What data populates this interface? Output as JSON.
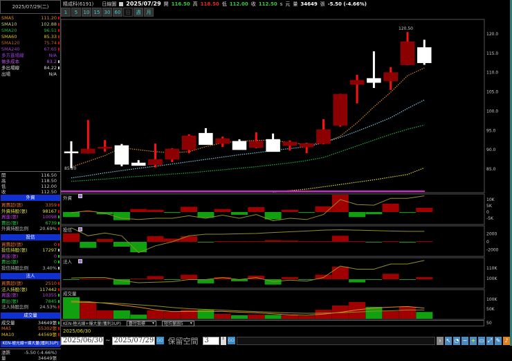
{
  "left": {
    "date": "2025/07/29(二)",
    "ma_rows": [
      {
        "label": "SMA5",
        "value": "111.20",
        "color": "#e08a20",
        "mark": "#e00000"
      },
      {
        "label": "SMA10",
        "value": "102.88",
        "color": "#c8c890",
        "mark": "#e00000"
      },
      {
        "label": "SMA20",
        "value": "96.51",
        "color": "#20b040",
        "mark": "#e00000"
      },
      {
        "label": "SMA60",
        "value": "85.33",
        "color": "#e0c020",
        "mark": "#e00000"
      },
      {
        "label": "SMA120",
        "value": "75.74",
        "color": "#c06020",
        "mark": "#e00000"
      },
      {
        "label": "SMA240",
        "value": "67.65",
        "color": "#a040c0",
        "mark": "#e00000"
      },
      {
        "label": "多方進場線",
        "value": "N/A",
        "color": "#a040e0",
        "mark": ""
      },
      {
        "label": "做多成本",
        "value": "83.2",
        "color": "#c050e0",
        "mark": "#ccc"
      },
      {
        "label": "多出場線",
        "value": "84.22",
        "color": "#ddd",
        "mark": "#ccc"
      },
      {
        "label": "出場",
        "value": "N/A",
        "color": "#ddd",
        "mark": ""
      }
    ],
    "ohlc_rows": [
      {
        "label": "開",
        "value": "116.50"
      },
      {
        "label": "高",
        "value": "118.50"
      },
      {
        "label": "低",
        "value": "112.00"
      },
      {
        "label": "收",
        "value": "112.50"
      }
    ],
    "sections": [
      {
        "title": "外資",
        "rows": [
          {
            "label": "買賣超(張)",
            "value": "3359",
            "color": "#e07030",
            "mark": "#e00000"
          },
          {
            "label": "外資持股(張)",
            "value": "98167",
            "color": "#e0e040",
            "mark": "#e00000"
          },
          {
            "label": "買進(張)",
            "value": "10098",
            "color": "#c040e0",
            "mark": "#20c020"
          },
          {
            "label": "賣出(張)",
            "value": "6739",
            "color": "#20d040",
            "mark": "#20c020"
          },
          {
            "label": "外資持股比例",
            "value": "20.69%",
            "color": "#bbb",
            "mark": "#e00000"
          }
        ]
      },
      {
        "title": "投信",
        "rows": [
          {
            "label": "買賣超(張)",
            "value": "0",
            "color": "#e07030",
            "mark": "#e00000"
          },
          {
            "label": "投信持股(張)",
            "value": "17297",
            "color": "#e0e040",
            "mark": "#ccc"
          },
          {
            "label": "買進(張)",
            "value": "0",
            "color": "#c040e0",
            "mark": "#20c020"
          },
          {
            "label": "賣出(張)",
            "value": "0",
            "color": "#20d040",
            "mark": "#20c020"
          },
          {
            "label": "投信持股比例",
            "value": "3.40%",
            "color": "#bbb",
            "mark": "#ccc"
          }
        ]
      },
      {
        "title": "法人",
        "rows": [
          {
            "label": "買賣超(張)",
            "value": "2510",
            "color": "#e07030",
            "mark": "#e00000"
          },
          {
            "label": "法人持股(張)",
            "value": "117442",
            "color": "#e0e040",
            "mark": "#e00000"
          },
          {
            "label": "買進(張)",
            "value": "10355",
            "color": "#c040e0",
            "mark": "#20c020"
          },
          {
            "label": "賣出(張)",
            "value": "7845",
            "color": "#20d040",
            "mark": "#20c020"
          },
          {
            "label": "法人持股比例",
            "value": "24.53%",
            "color": "#bbb",
            "mark": "#e00000"
          }
        ]
      },
      {
        "title": "成交量",
        "rows": [
          {
            "label": "成交量",
            "value": "34649張",
            "color": "#ddd",
            "mark": "#20c020"
          },
          {
            "label": "MA5",
            "value": "55302張",
            "color": "#e07030",
            "mark": "#e00000"
          },
          {
            "label": "MA10",
            "value": "44569張",
            "color": "#e0c020",
            "mark": "#e00000"
          }
        ]
      }
    ],
    "ken_label": "KEN-極光線+爆大量(獲利3UP)",
    "footer_rows": [
      {
        "label": "漲跌",
        "value": "-5.50 (-4.66%)"
      },
      {
        "label": "量",
        "value": "34649張"
      }
    ]
  },
  "topbar": {
    "stock": "精成科(6191)",
    "chart_type": "日線圖",
    "date": "2025/07/29",
    "open_label": "開",
    "open": "116.50",
    "high_label": "高",
    "high": "118.50",
    "low_label": "低",
    "low": "112.00",
    "close_label": "收",
    "close": "112.50",
    "unit1": "s",
    "unit2": "元",
    "vol_label": "量",
    "volume": "34649",
    "vol_unit": "張",
    "change": "-5.50 (-4.66%)"
  },
  "periods": [
    {
      "label": "1"
    },
    {
      "label": "5"
    },
    {
      "label": "10"
    },
    {
      "label": "15"
    },
    {
      "label": "30"
    },
    {
      "label": "60"
    },
    {
      "label": "日",
      "selected": true
    },
    {
      "label": "週"
    },
    {
      "label": "月"
    }
  ],
  "panels": {
    "foreign": "外資",
    "trust": "投信",
    "inst": "法人",
    "volume": "成交量"
  },
  "bottom": {
    "ken_label": "KEN-極光線+爆大量(獲利3UP)",
    "overlay_select": "疊付指標",
    "vol_select": "短均量圖5",
    "cursor_date": "2025/06/30",
    "start_date": "2025/06/30",
    "tilde": "~",
    "end_date": "2025/07/29",
    "go": "GO",
    "reserve_label": "保留空間",
    "reserve_value": "3",
    "right_axis_50": "50"
  },
  "colors": {
    "up_body": "#8b0000",
    "up_wick": "#ff1010",
    "down": "#ffffff",
    "ma5": "#e08a20",
    "ma10": "#80c8e0",
    "ma20": "#20b040",
    "ma60": "#e0e020",
    "bar_up": "#a00000",
    "bar_down": "#10a010",
    "line": "#909020"
  },
  "chart_data": [
    {
      "type": "candlestick",
      "title": "",
      "ylim": [
        79,
        123.4
      ],
      "yticks": [
        "120.0",
        "115.0",
        "110.0",
        "105.0",
        "100.0",
        "95.0",
        "90.0",
        "85.0"
      ],
      "ytick_values": [
        120,
        115,
        110,
        105,
        100,
        95,
        90,
        85
      ],
      "annotations": [
        {
          "text": "120.50",
          "index": 20
        },
        {
          "text": "85.20",
          "index": 0
        }
      ],
      "ohlc": [
        [
          89.5,
          92.2,
          85.2,
          89.3
        ],
        [
          89.1,
          97.7,
          89.0,
          90.2
        ],
        [
          90.5,
          92.5,
          89.5,
          90.7
        ],
        [
          91.1,
          91.5,
          85.7,
          86.2
        ],
        [
          86.6,
          87.3,
          85.9,
          85.9
        ],
        [
          86.1,
          91.6,
          85.4,
          87.5
        ],
        [
          87.5,
          90.4,
          86.8,
          90.2
        ],
        [
          90.0,
          94.0,
          89.1,
          93.6
        ],
        [
          94.3,
          95.6,
          91.3,
          91.3
        ],
        [
          91.6,
          93.4,
          90.7,
          92.9
        ],
        [
          92.2,
          92.7,
          90.0,
          90.0
        ],
        [
          90.6,
          94.5,
          90.4,
          92.2
        ],
        [
          92.7,
          94.2,
          89.5,
          89.5
        ],
        [
          91.1,
          92.4,
          89.8,
          92.0
        ],
        [
          90.7,
          91.8,
          89.1,
          91.6
        ],
        [
          91.6,
          97.9,
          91.4,
          95.2
        ],
        [
          96.3,
          104.5,
          96.0,
          104.4
        ],
        [
          106.9,
          109.4,
          102.0,
          108.0
        ],
        [
          108.5,
          115.5,
          106.0,
          107.4
        ],
        [
          107.8,
          111.4,
          105.5,
          110.0
        ],
        [
          112.0,
          120.5,
          111.9,
          118.0
        ],
        [
          116.5,
          118.5,
          112.0,
          112.5
        ]
      ],
      "ma": {
        "SMA5": [
          85.5,
          87,
          88.5,
          90.5,
          90,
          89.5,
          89.2,
          89.5,
          90.8,
          91.8,
          92.2,
          92.4,
          92.5,
          91.8,
          91.4,
          91.8,
          93.5,
          97,
          101.1,
          104.9,
          109.2,
          111.2
        ],
        "SMA10": [
          82.7,
          83.3,
          84,
          84.6,
          85.2,
          85.7,
          86.3,
          86.9,
          87.5,
          88.1,
          88.7,
          89.2,
          89.8,
          90.3,
          90.8,
          91.8,
          93.2,
          94.8,
          96.5,
          98.3,
          100.7,
          102.9
        ],
        "SMA20": [
          81.8,
          82.1,
          82.4,
          82.8,
          83.1,
          83.4,
          83.7,
          84,
          84.4,
          84.8,
          85.2,
          85.6,
          86.1,
          86.6,
          87.2,
          88,
          89.5,
          91,
          92.5,
          94,
          95.3,
          96.4
        ],
        "SMA60": [
          null,
          null,
          null,
          null,
          null,
          null,
          null,
          null,
          null,
          null,
          null,
          null,
          79.1,
          79.4,
          79.8,
          80.4,
          81.0,
          81.6,
          82.2,
          82.9,
          83.6,
          85.3
        ]
      }
    },
    {
      "type": "bar",
      "name": "外資",
      "yticks": [
        "10K",
        "5K",
        "0",
        "-5K"
      ],
      "ytick_values": [
        10,
        5,
        0,
        -5
      ],
      "values": [
        -4,
        0,
        -1.8,
        -6.5,
        2.4,
        1.8,
        -0.5,
        4.2,
        -4.6,
        2.4,
        -2.2,
        3.9,
        -5.9,
        1.8,
        -0.4,
        4.6,
        13.9,
        -4,
        -1.7,
        6.7,
        -0.6,
        3.4
      ],
      "line": [
        -0.5,
        1,
        -1,
        -5,
        -6,
        -5,
        -5,
        -3,
        -5,
        -2.5,
        -5,
        -2,
        -7,
        -5,
        -6,
        -2,
        10,
        6,
        5.5,
        11,
        11,
        13
      ]
    },
    {
      "type": "bar",
      "name": "投信",
      "yticks": [
        "2000",
        "0",
        "-2000"
      ],
      "ytick_values": [
        2000,
        0,
        -2000
      ],
      "values": [
        2100,
        -1500,
        700,
        -1200,
        -2600,
        1400,
        800,
        1400,
        -50,
        20,
        30,
        100,
        400,
        300,
        100,
        100,
        1500,
        50,
        -100,
        100,
        -200,
        0
      ],
      "line": [
        3500,
        1500,
        2200,
        1500,
        -2700,
        -1000,
        0,
        1500,
        1900,
        1900,
        2000,
        2100,
        2300,
        2500,
        2700,
        2900,
        3000,
        2900,
        2800,
        2700,
        2600,
        2600
      ]
    },
    {
      "type": "bar",
      "name": "法人",
      "yticks": [
        "110K",
        "100K"
      ],
      "ytick_values": [
        110,
        100
      ],
      "values": [
        -0.2,
        0,
        0,
        -6,
        0,
        3.5,
        -0.3,
        5,
        -4.5,
        2.4,
        -2.2,
        3.9,
        -5.9,
        2.5,
        -0.4,
        5,
        14,
        -3.5,
        -0.5,
        6,
        -0.5,
        2.5
      ],
      "line": [
        100.5,
        101,
        101,
        98,
        96,
        96.5,
        97,
        99,
        99,
        101,
        99,
        101,
        97,
        98.5,
        97.5,
        101,
        112,
        109,
        109,
        114,
        114,
        117.4
      ]
    },
    {
      "type": "bar",
      "name": "成交量",
      "yticks": [
        "100K",
        "50K"
      ],
      "ytick_values": [
        100,
        50
      ],
      "values": [
        111,
        82,
        43,
        43,
        21,
        43,
        36,
        46,
        46,
        25,
        18,
        21,
        20,
        18,
        14,
        46,
        68,
        86,
        61,
        39,
        61,
        35
      ],
      "ma5": [
        90,
        88,
        80,
        70,
        60,
        46,
        37,
        38,
        38,
        38,
        34,
        31,
        26,
        20,
        18,
        24,
        33,
        46,
        55,
        60,
        63,
        55
      ],
      "ma10": [
        85,
        84,
        82,
        78,
        72,
        66,
        58,
        52,
        48,
        44,
        40,
        37,
        33,
        30,
        28,
        29,
        31,
        35,
        39,
        41,
        45,
        45
      ]
    }
  ]
}
